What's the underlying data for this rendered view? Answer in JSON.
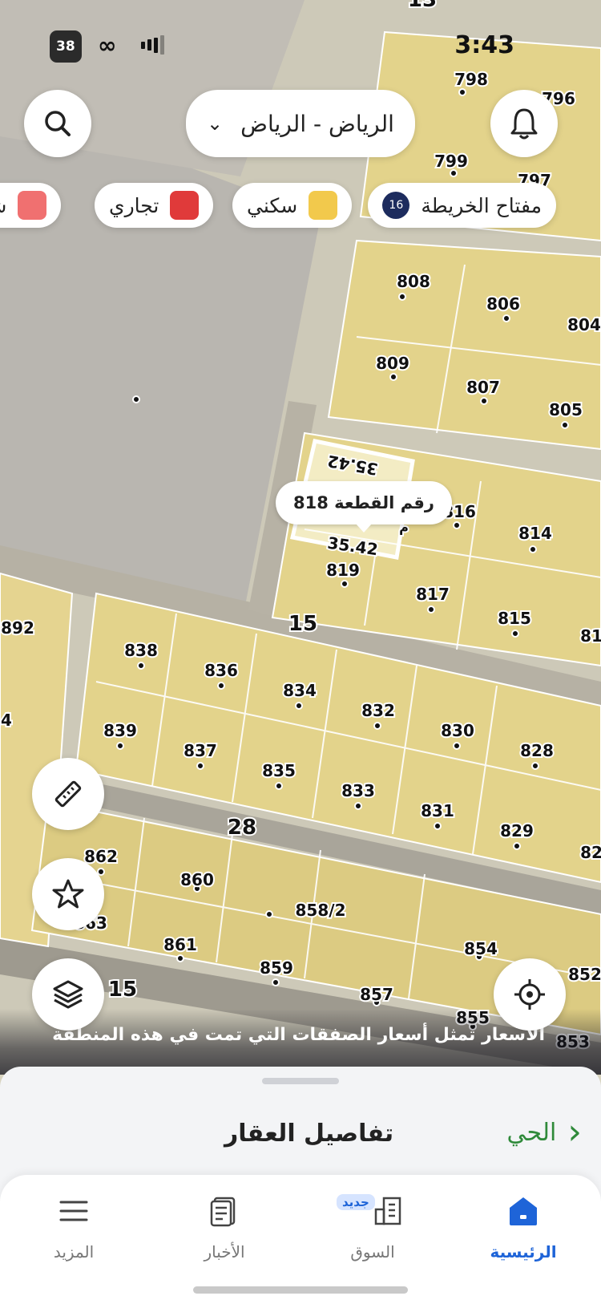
{
  "status_bar": {
    "battery": "38",
    "time": "3:43"
  },
  "header": {
    "city_selector": "الرياض - الرياض"
  },
  "legend": {
    "map_key_label": "مفتاح الخريطة",
    "map_key_badge": "16",
    "items": [
      {
        "label": "سكني",
        "color": "#f2c94c"
      },
      {
        "label": "تجاري",
        "color": "#e03a3a"
      },
      {
        "label": "شـ",
        "color": "#f07070"
      }
    ]
  },
  "map": {
    "selected_parcel_label": "رقم القطعة 818",
    "dimension_top": "35.42",
    "dimension_bottom": "35.42",
    "dimension_side": "م",
    "parcel_numbers": [
      "798",
      "796",
      "799",
      "797",
      "808",
      "806",
      "804",
      "809",
      "807",
      "805",
      "816",
      "814",
      "819",
      "817",
      "815",
      "81",
      "892",
      "838",
      "836",
      "834",
      "832",
      "830",
      "828",
      "839",
      "837",
      "835",
      "833",
      "831",
      "829",
      "82",
      "4",
      "862",
      "860",
      "858/2",
      "863",
      "861",
      "859",
      "854",
      "852",
      "857",
      "855",
      "853"
    ],
    "street_numbers": [
      "15",
      "28",
      "15",
      "13"
    ],
    "footer_note": "الأسعار تمثل أسعار الصفقات التي تمت في هذه المنطقة"
  },
  "sheet": {
    "title": "تفاصيل العقار",
    "district": "الحي"
  },
  "nav": {
    "home": "الرئيسية",
    "market": "السوق",
    "new_badge": "جديد",
    "news": "الأخبار",
    "more": "المزيد"
  },
  "colors": {
    "accent": "#1e64d8",
    "district_green": "#2f8a3a",
    "parcel_fill": "#e4d48c"
  }
}
